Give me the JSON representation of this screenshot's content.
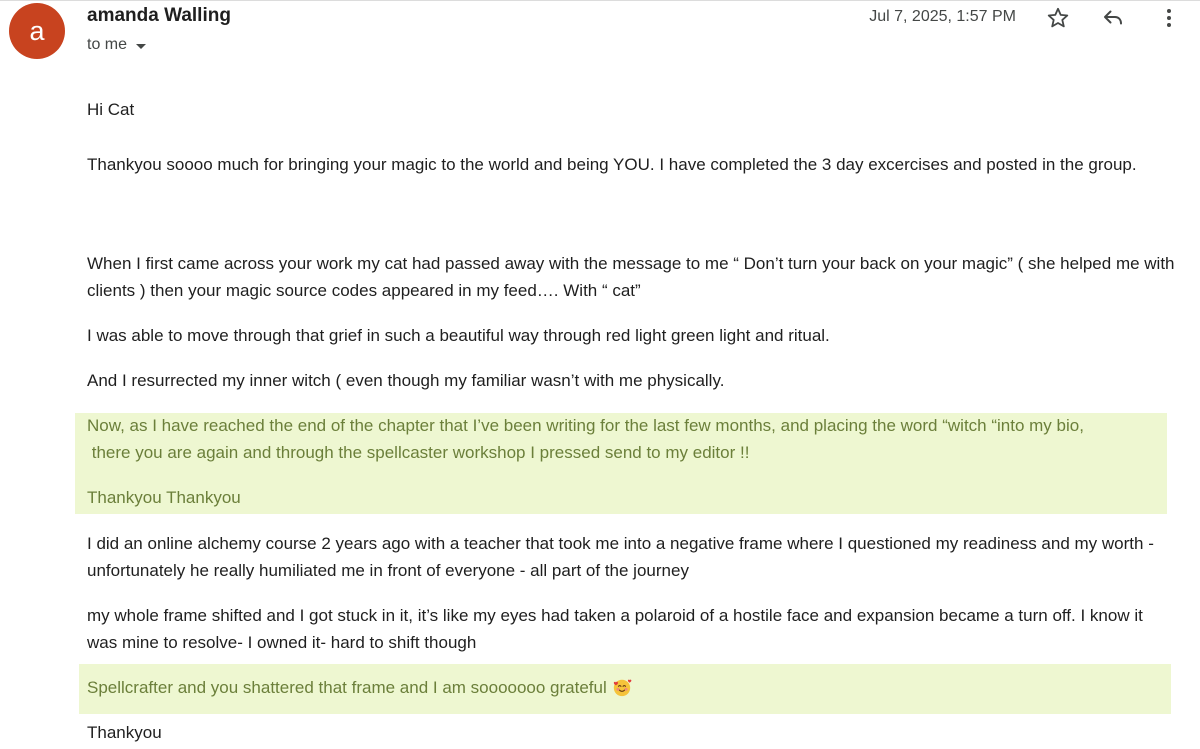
{
  "header": {
    "avatar_letter": "a",
    "sender_name": "amanda Walling",
    "recipient": "to me",
    "date": "Jul 7, 2025, 1:57 PM"
  },
  "icons": {
    "star": "star-icon",
    "reply": "reply-icon",
    "more": "more-vert-icon",
    "emoji": "smiling-face-with-hearts-emoji"
  },
  "colors": {
    "avatar": "#c8431f",
    "highlight_bg": "#eef7d1",
    "highlight_text": "#6b7f3a"
  },
  "message": {
    "greeting": "Hi Cat",
    "p1": "Thankyou soooo much for bringing your magic to the world and being YOU. I have completed the 3 day excercises and posted in the group.",
    "p2": "When I first came across your work my cat had passed away with the message to me “ Don’t turn your back on your magic” ( she helped me with clients ) then your magic source codes appeared in my feed…. With “ cat”",
    "p3": "I was able to move through that grief in such a beautiful way through red light green light and ritual.",
    "p4": "And I resurrected my inner witch ( even though my familiar wasn’t with me physically.",
    "hl1_line1": "Now, as I have reached the end of the chapter that I’ve been writing for the last few months, and placing the word “witch “into my bio,",
    "hl1_line2": " there you are again and through the spellcaster workshop I pressed send to my editor !!",
    "hl1_thanks": "Thankyou Thankyou",
    "p5": "I did an online alchemy course 2 years ago with a teacher that took me into a negative frame where I questioned my readiness and my worth - unfortunately he really humiliated me in front of everyone - all part of the journey",
    "p6": "my whole frame shifted and I got stuck in it, it’s like my eyes had taken a polaroid of a hostile face and expansion became a turn off. I know it was mine to resolve- I owned it- hard to shift though",
    "hl2": "Spellcrafter and you shattered that frame and I am sooooooo grateful",
    "closing": "Thankyou"
  }
}
